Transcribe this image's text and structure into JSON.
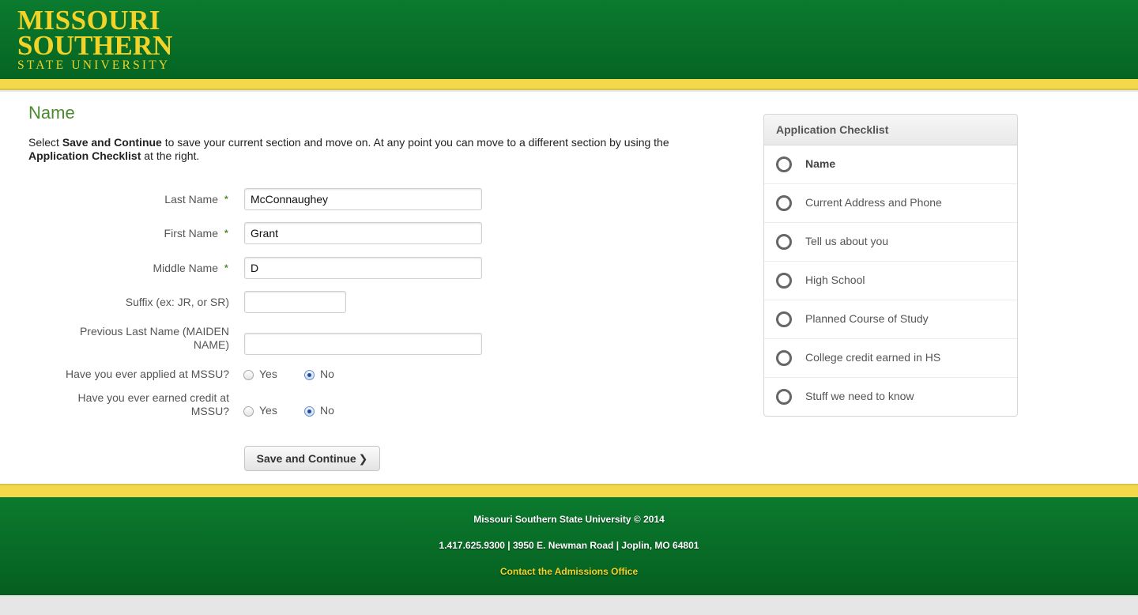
{
  "header": {
    "logo_line1": "MISSOURI",
    "logo_line2": "SOUTHERN",
    "logo_line3": "STATE UNIVERSITY",
    "brand_green": "#0b7a2e",
    "brand_gold": "#f3d327"
  },
  "page": {
    "title": "Name",
    "intro_pre": "Select ",
    "intro_bold1": "Save and Continue",
    "intro_mid": " to save your current section and move on. At any point you can move to a different section by using the ",
    "intro_bold2": "Application Checklist",
    "intro_post": " at the right."
  },
  "form": {
    "required_mark": "*",
    "last_name": {
      "label": "Last Name",
      "value": "McConnaughey",
      "required": true
    },
    "first_name": {
      "label": "First Name",
      "value": "Grant",
      "required": true
    },
    "middle_name": {
      "label": "Middle Name",
      "value": "D",
      "required": true
    },
    "suffix": {
      "label": "Suffix (ex: JR, or SR)",
      "value": ""
    },
    "previous_last_name": {
      "label_line1": "Previous Last Name (MAIDEN",
      "label_line2": "NAME)",
      "value": ""
    },
    "applied": {
      "label": "Have you ever applied at MSSU?",
      "yes": "Yes",
      "no": "No",
      "selected": "No"
    },
    "earned_credit": {
      "label_line1": "Have you ever earned credit at",
      "label_line2": "MSSU?",
      "yes": "Yes",
      "no": "No",
      "selected": "No"
    },
    "save_button": "Save and Continue",
    "save_icon": "chevron-right-icon"
  },
  "checklist": {
    "title": "Application Checklist",
    "items": [
      {
        "label": "Name",
        "active": true
      },
      {
        "label": "Current Address and Phone"
      },
      {
        "label": "Tell us about you"
      },
      {
        "label": "High School"
      },
      {
        "label": "Planned Course of Study"
      },
      {
        "label": "College credit earned in HS"
      },
      {
        "label": "Stuff we need to know"
      }
    ]
  },
  "footer": {
    "copyright": "Missouri Southern State University © 2014",
    "contact_line": "1.417.625.9300 | 3950 E. Newman Road | Joplin, MO 64801",
    "contact_link": "Contact the Admissions Office"
  }
}
